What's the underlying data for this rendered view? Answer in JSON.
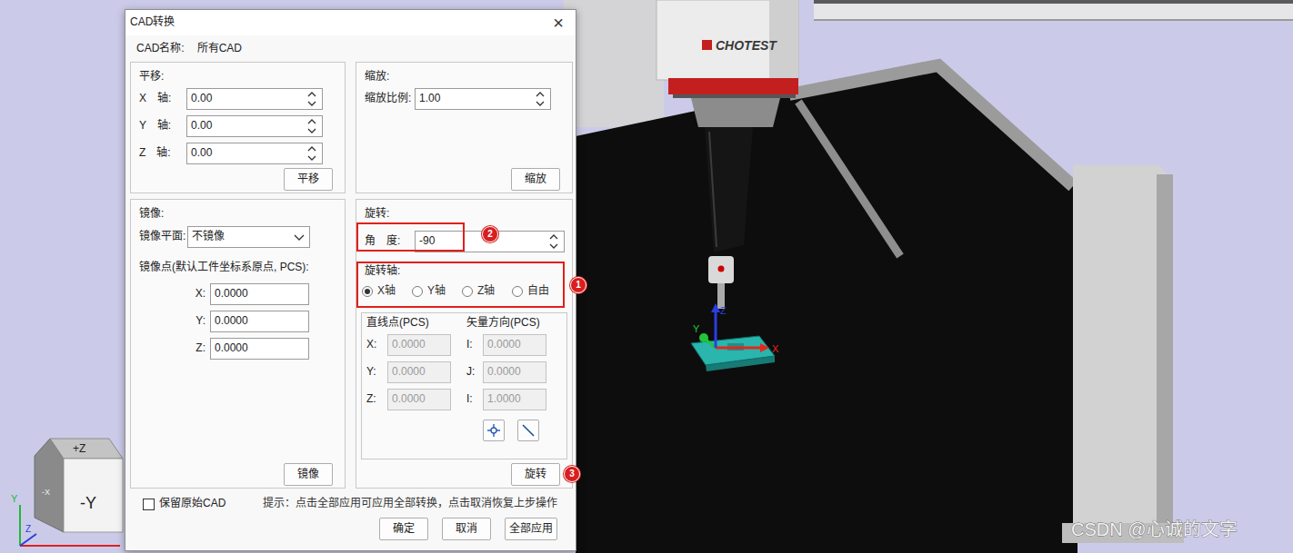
{
  "scene": {
    "logo": "CHOTEST",
    "watermark": "CSDN @心诚的文字",
    "part_axes": [
      {
        "label": "X",
        "color": "#e8261c"
      },
      {
        "label": "Y",
        "color": "#22c43a"
      },
      {
        "label": "Z",
        "color": "#2a3ee0"
      }
    ],
    "view_cube": {
      "top": "+Z",
      "front": "-Y",
      "left": "-X"
    },
    "corner_axes": [
      {
        "label": "Y",
        "color": "#22b83a"
      },
      {
        "label": "Z",
        "color": "#2a3ee0"
      }
    ]
  },
  "window": {
    "title": "CAD转换",
    "close": "×"
  },
  "cad_name": {
    "label": "CAD名称:",
    "value": "所有CAD"
  },
  "translate": {
    "title": "平移:",
    "fields": [
      {
        "label": "X　轴:",
        "value": "0.00"
      },
      {
        "label": "Y　轴:",
        "value": "0.00"
      },
      {
        "label": "Z　轴:",
        "value": "0.00"
      }
    ],
    "button": "平移"
  },
  "scale": {
    "title": "缩放:",
    "label": "缩放比例:",
    "value": "1.00",
    "button": "缩放"
  },
  "mirror": {
    "title": "镜像:",
    "plane_label": "镜像平面:",
    "plane_value": "不镜像",
    "point_label": "镜像点(默认工件坐标系原点, PCS):",
    "points": [
      {
        "label": "X:",
        "value": "0.0000"
      },
      {
        "label": "Y:",
        "value": "0.0000"
      },
      {
        "label": "Z:",
        "value": "0.0000"
      }
    ],
    "button": "镜像"
  },
  "rotate": {
    "title": "旋转:",
    "angle_label": "角　度:",
    "angle_value": "-90",
    "axis_label": "旋转轴:",
    "axes": [
      {
        "label": "X轴",
        "selected": true
      },
      {
        "label": "Y轴",
        "selected": false
      },
      {
        "label": "Z轴",
        "selected": false
      },
      {
        "label": "自由",
        "selected": false
      }
    ],
    "line_point_label": "直线点(PCS)",
    "vector_label": "矢量方向(PCS)",
    "line_points": [
      {
        "label": "X:",
        "value": "0.0000",
        "disabled": true
      },
      {
        "label": "Y:",
        "value": "0.0000",
        "disabled": true
      },
      {
        "label": "Z:",
        "value": "0.0000",
        "disabled": true
      }
    ],
    "vector": [
      {
        "label": "I:",
        "value": "0.0000",
        "disabled": true
      },
      {
        "label": "J:",
        "value": "0.0000",
        "disabled": true
      },
      {
        "label": "I:",
        "value": "1.0000",
        "disabled": true
      }
    ],
    "button": "旋转"
  },
  "annotations": [
    {
      "number": "1"
    },
    {
      "number": "2"
    },
    {
      "number": "3"
    }
  ],
  "footer": {
    "keep_original": {
      "label": "保留原始CAD",
      "checked": false
    },
    "hint": "提示：点击全部应用可应用全部转换，点击取消恢复上步操作",
    "buttons": [
      "确定",
      "取消",
      "全部应用"
    ]
  }
}
